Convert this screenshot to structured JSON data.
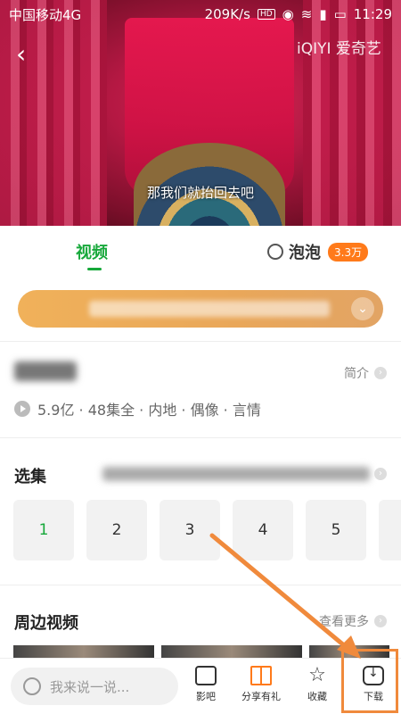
{
  "status_bar": {
    "carrier": "中国移动4G",
    "speed": "209K/s",
    "hd": "HD",
    "time": "11:29"
  },
  "video": {
    "brand": "爱奇艺",
    "subtitle": "那我们就抬回去吧"
  },
  "tabs": {
    "video": "视频",
    "paopao": "泡泡",
    "paopao_badge": "3.3万"
  },
  "info": {
    "intro_label": "简介",
    "meta": "5.9亿 · 48集全 · 内地 · 偶像 · 言情"
  },
  "episodes": {
    "title": "选集",
    "items": [
      "1",
      "2",
      "3",
      "4",
      "5"
    ]
  },
  "related": {
    "title": "周边视频",
    "more_label": "查看更多"
  },
  "bottom_bar": {
    "comment_placeholder": "我来说一说...",
    "forum_label": "影吧",
    "share_label": "分享有礼",
    "favorite_label": "收藏",
    "download_label": "下载"
  },
  "colors": {
    "accent_green": "#16a83a",
    "badge_orange": "#ff7a1a",
    "annotation_orange": "#f08a3c"
  }
}
